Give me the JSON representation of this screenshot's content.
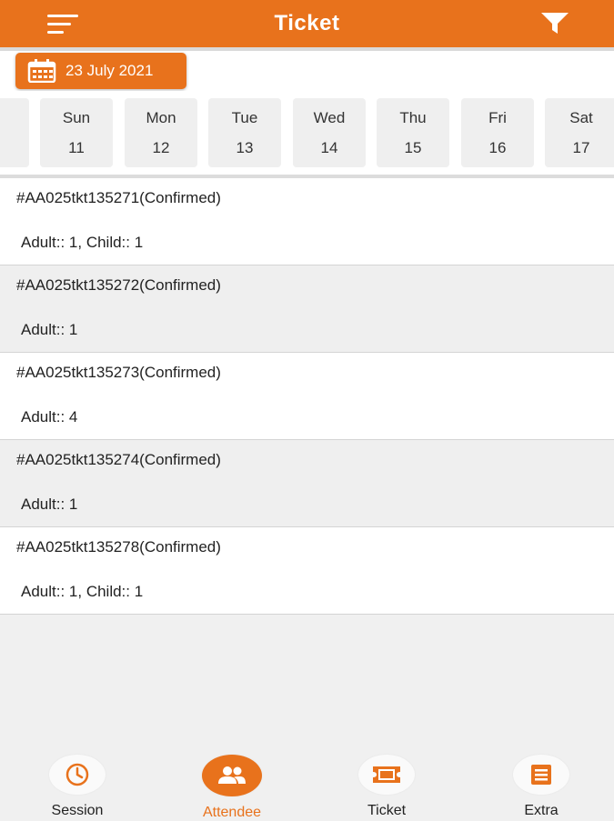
{
  "header": {
    "title": "Ticket",
    "menu_icon": "menu-icon",
    "filter_icon": "filter-icon"
  },
  "date_picker": {
    "label": "23 July 2021",
    "icon": "calendar-icon"
  },
  "week": [
    {
      "day": "Sun",
      "date": "11"
    },
    {
      "day": "Mon",
      "date": "12"
    },
    {
      "day": "Tue",
      "date": "13"
    },
    {
      "day": "Wed",
      "date": "14"
    },
    {
      "day": "Thu",
      "date": "15"
    },
    {
      "day": "Fri",
      "date": "16"
    },
    {
      "day": "Sat",
      "date": "17"
    }
  ],
  "tickets": [
    {
      "id": "#AA025tkt135271(Confirmed)",
      "counts": "Adult:: 1, Child:: 1"
    },
    {
      "id": "#AA025tkt135272(Confirmed)",
      "counts": "Adult:: 1"
    },
    {
      "id": "#AA025tkt135273(Confirmed)",
      "counts": "Adult:: 4"
    },
    {
      "id": "#AA025tkt135274(Confirmed)",
      "counts": "Adult:: 1"
    },
    {
      "id": "#AA025tkt135278(Confirmed)",
      "counts": "Adult:: 1, Child:: 1"
    }
  ],
  "bottom_nav": [
    {
      "label": "Session",
      "icon": "clock-icon",
      "active": false
    },
    {
      "label": "Attendee",
      "icon": "people-icon",
      "active": true
    },
    {
      "label": "Ticket",
      "icon": "ticket-icon",
      "active": false
    },
    {
      "label": "Extra",
      "icon": "list-icon",
      "active": false
    }
  ],
  "colors": {
    "accent": "#e8721c",
    "background": "#f0f0f0",
    "row_alt": "#efefef",
    "white": "#ffffff"
  }
}
